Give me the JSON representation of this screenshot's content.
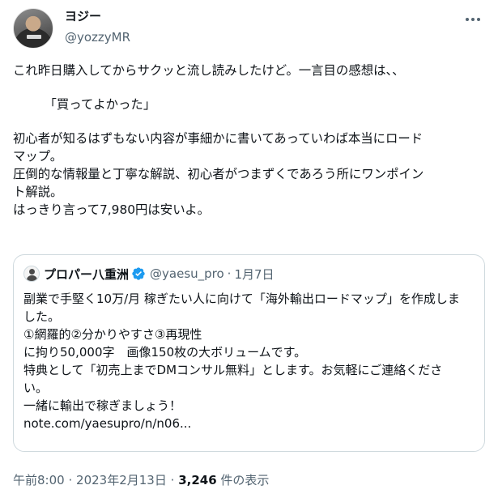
{
  "author": {
    "name": "ヨジー",
    "handle": "@yozzyMR",
    "more_icon": "more-icon"
  },
  "tweet": {
    "lines": [
      "これ昨日購入してからサクッと流し読みしたけど。一言目の感想は、、",
      "",
      "　　　「買ってよかった」",
      "",
      "初心者が知るはずもない内容が事細かに書いてあっていわば本当にロード",
      "マップ。",
      "圧倒的な情報量と丁寧な解説、初心者がつまずくであろう所にワンポイン",
      "ト解説。",
      "はっきり言って7,980円は安いよ。"
    ]
  },
  "quote": {
    "name": "プロパー八重洲",
    "handle": "@yaesu_pro",
    "separator": "·",
    "date": "1月7日",
    "verified_icon": "verified-badge-icon",
    "verified_color": "#1d9bf0",
    "lines": [
      "副業で手堅く10万/月 稼ぎたい人に向けて「海外輸出ロードマップ」を作成しま",
      "した。",
      "①網羅的②分かりやすさ③再現性",
      "に拘り50,000字　画像150枚の大ボリュームです。",
      "特典として「初売上までDMコンサル無料」とします。お気軽にご連絡くださ",
      "い。",
      "一緒に輸出で稼ぎましょう！",
      "note.com/yaesupro/n/n06..."
    ]
  },
  "footer": {
    "time": "午前8:00",
    "sep1": "·",
    "date": "2023年2月13日",
    "sep2": "·",
    "views_count": "3,246",
    "views_label": "件の表示"
  },
  "colors": {
    "text": "#0f1419",
    "muted": "#536471",
    "border": "#cfd9de"
  }
}
